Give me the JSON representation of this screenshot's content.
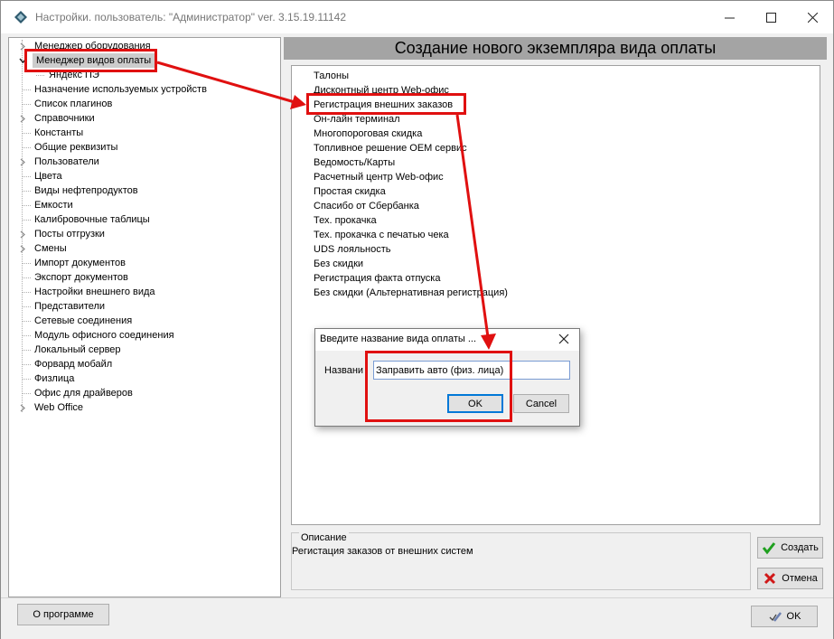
{
  "window": {
    "title": "Настройки. пользователь: \"Администратор\" ver. 3.15.19.11142",
    "minimize_label": "minimize",
    "maximize_label": "maximize",
    "close_label": "close"
  },
  "tree": {
    "items": [
      {
        "label": "Менеджер оборудования",
        "expander": true
      },
      {
        "label": "Менеджер видов оплаты",
        "expander": true,
        "expanded": true,
        "selected": true
      },
      {
        "label": "Яндекс ПЭ",
        "child": true
      },
      {
        "label": "Назначение используемых устройств"
      },
      {
        "label": "Список плагинов"
      },
      {
        "label": "Справочники",
        "expander": true
      },
      {
        "label": "Константы"
      },
      {
        "label": "Общие реквизиты"
      },
      {
        "label": "Пользователи",
        "expander": true
      },
      {
        "label": "Цвета"
      },
      {
        "label": "Виды нефтепродуктов"
      },
      {
        "label": "Емкости"
      },
      {
        "label": "Калибровочные таблицы"
      },
      {
        "label": "Посты отгрузки",
        "expander": true
      },
      {
        "label": "Смены",
        "expander": true
      },
      {
        "label": "Импорт документов"
      },
      {
        "label": "Экспорт документов"
      },
      {
        "label": "Настройки внешнего вида"
      },
      {
        "label": "Представители"
      },
      {
        "label": "Сетевые соединения"
      },
      {
        "label": "Модуль офисного соединения"
      },
      {
        "label": "Локальный сервер"
      },
      {
        "label": "Форвард мобайл"
      },
      {
        "label": "Физлица"
      },
      {
        "label": "Офис для драйверов"
      },
      {
        "label": "Web Office",
        "expander": true
      }
    ]
  },
  "main": {
    "header": "Создание нового экземпляра вида оплаты",
    "types": [
      "Талоны",
      "Дисконтный центр Web-офис",
      "Регистрация внешних заказов",
      "Он-лайн терминал",
      "Многопороговая скидка",
      "Топливное решение OEM сервис",
      "Ведомость/Карты",
      "Расчетный центр Web-офис",
      "Простая скидка",
      "Спасибо от Сбербанка",
      "Тех. прокачка",
      "Тех. прокачка с печатью чека",
      "UDS лояльность",
      "Без скидки",
      "Регистрация факта отпуска",
      "Без скидки (Альтернативная регистрация)"
    ],
    "description_label": "Описание",
    "description_text": "Регистация заказов от внешних систем",
    "create_label": "Создать",
    "cancel_label": "Отмена"
  },
  "bottom": {
    "about_label": "О программе",
    "ok_label": "OK"
  },
  "dialog": {
    "title": "Введите название вида оплаты ...",
    "name_label": "Названи",
    "name_value": "Заправить авто (физ. лица)",
    "ok_label": "OK",
    "cancel_label": "Cancel"
  },
  "colors": {
    "annotation": "#e01010",
    "header_bg": "#a4a4a4",
    "create_icon": "#1fa01f",
    "cancel_icon": "#d01818"
  }
}
